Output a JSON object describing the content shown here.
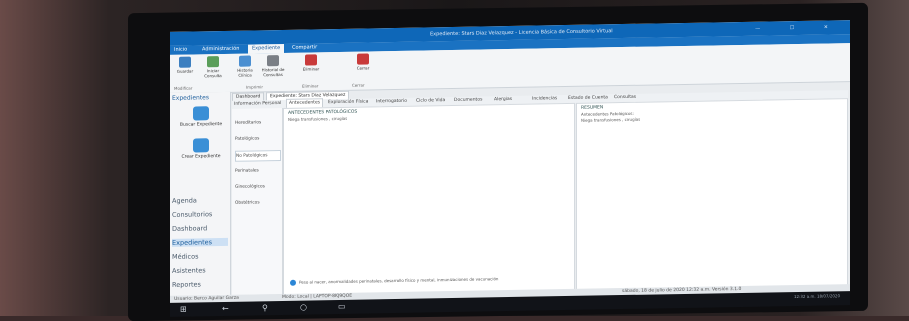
{
  "titlebar": {
    "title": "Expediente: Stars Diaz Velazquez - Licencia Básica de Consultorio Virtual",
    "controls": "— ☐ ✕"
  },
  "menu": {
    "items": [
      "Inicio",
      "Administración",
      "Expediente",
      "Compartir"
    ]
  },
  "ribbon": {
    "buttons": [
      {
        "label": "Guardar",
        "color": "#3c7fc0"
      },
      {
        "label": "Iniciar Consulta",
        "color": "#5a9e5a"
      },
      {
        "label": "Historia Clínica",
        "color": "#4b8fd1"
      },
      {
        "label": "Historial de Consultas",
        "color": "#7a7f86"
      },
      {
        "label": "Eliminar",
        "color": "#c83a3a"
      },
      {
        "label": "Cerrar",
        "color": "#c83a3a"
      }
    ],
    "groups": [
      "Modificar",
      "Imprimir",
      "Eliminar",
      "Cerrar"
    ]
  },
  "sidebar": {
    "header": "Expedientes",
    "actions": [
      {
        "label": "Buscar Expediente",
        "color": "#3a8fd6"
      },
      {
        "label": "Crear Expediente",
        "color": "#3a8fd6"
      }
    ],
    "nav": [
      "Agenda",
      "Consultorios",
      "Dashboard",
      "Expedientes",
      "Médicos",
      "Asistentes",
      "Reportes"
    ]
  },
  "doctabs": [
    "Dashboard",
    "Expediente: Stars Diaz Velazquez"
  ],
  "subtabs": [
    "Información Personal",
    "Antecedentes",
    "Exploración Física",
    "Interrogatorio",
    "Ciclo de Vida",
    "Documentos",
    "Alergias",
    "Incidencias",
    "Estado de Cuenta",
    "Consultas"
  ],
  "antecedentes": [
    "Hereditarios",
    "Patológicos",
    "No Patológicos",
    "Perinatales",
    "Ginecológicos",
    "Obstétricos"
  ],
  "content": {
    "title": "ANTECEDENTES PATOLÓGICOS",
    "sub": "Niega transfusiones , cirugías",
    "note": "Peso al nacer, anormalidades perinatales, desarrollo físico y mental, inmunizaciones de vacunación"
  },
  "resumen": {
    "title": "RESUMEN",
    "lines": [
      "Antecedentes Patológicos:",
      "Niega transfusiones , cirugías"
    ]
  },
  "status": {
    "user": "Usuario: Berco Aguilar Garza",
    "mode": "Modo: Local | LAPTOP-8KJ9QOE",
    "date": "sábado, 18 de julio de 2020 12:32 a.m.   Versión 3.1.0"
  },
  "taskbar": {
    "time": "12:32 a.m.",
    "date": "18/07/2020"
  }
}
